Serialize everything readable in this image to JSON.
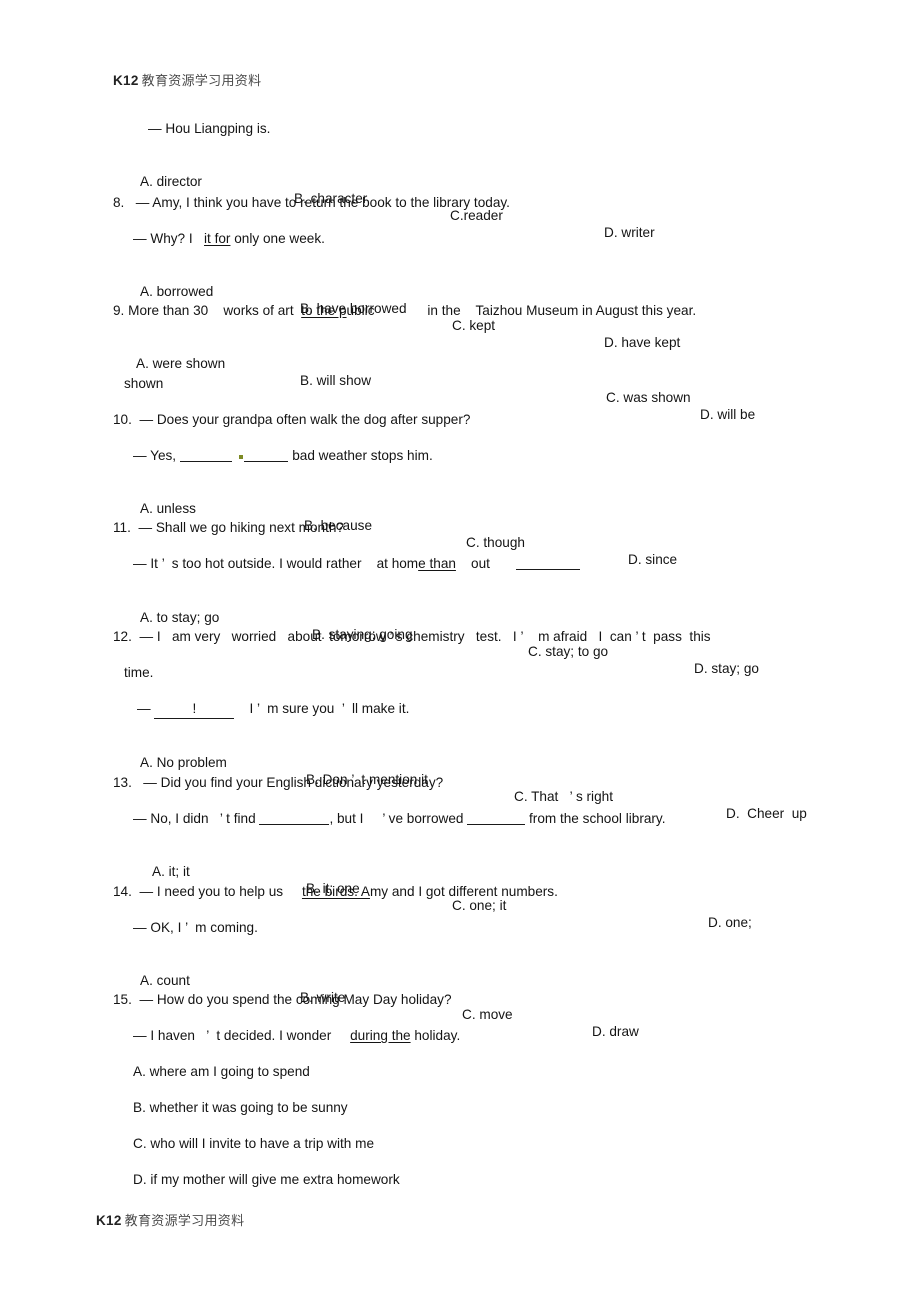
{
  "document": {
    "running_head": {
      "latin": "K12",
      "cjk": "教育资源学习用资料"
    },
    "running_foot": {
      "latin": "K12",
      "cjk": "教育资源学习用资料"
    }
  },
  "questions": [
    {
      "number": "",
      "stem": "— Hou Liangping is.",
      "options": [
        {
          "label": "A. director"
        },
        {
          "label": "B. character"
        },
        {
          "label": "C.reader"
        },
        {
          "label": "D. writer"
        }
      ]
    },
    {
      "number": "8.",
      "stem": "— Amy, I think you have to return the book to the library today.",
      "reply_pre": "— Why? I",
      "reply_underlined": "it for",
      "reply_post": " only one week.",
      "options": [
        {
          "label": "A. borrowed"
        },
        {
          "label": "B. have borrowed"
        },
        {
          "label": "C. kept"
        },
        {
          "label": "D. have kept"
        }
      ]
    },
    {
      "number": "9.",
      "stem_a": "More than 30",
      "stem_b": "works of art",
      "stem_underlined": "to the p",
      "stem_c": "ublic",
      "stem_d": "in the",
      "stem_e": "Taizhou Museum in August this year.",
      "options": [
        {
          "label": "A. were shown"
        },
        {
          "label": "B. will show"
        },
        {
          "label": "C. was shown"
        },
        {
          "label": "D. will be"
        },
        {
          "label": "shown"
        }
      ]
    },
    {
      "number": "10.",
      "stem": "— Does your grandpa often walk the dog after supper?",
      "reply_pre": "— Yes,",
      "reply_post": " bad weather stops him.",
      "options": [
        {
          "label": "A. unless"
        },
        {
          "label": "B. because"
        },
        {
          "label": "C. though"
        },
        {
          "label": "D. since"
        }
      ]
    },
    {
      "number": "11.",
      "stem": "— Shall we go hiking next month?",
      "reply_a": "— It",
      "reply_apos": "’",
      "reply_b": "s too hot outside. I would rather",
      "reply_c": "at hom",
      "reply_underlined": "e than",
      "reply_d": "out",
      "options": [
        {
          "label": "A. to stay; go"
        },
        {
          "label": "B. staying; going"
        },
        {
          "label": "C. stay; to go"
        },
        {
          "label": "D. stay; go"
        }
      ]
    },
    {
      "number": "12.",
      "stem_line1": "— I   am very   worried   about  tomorrow ’ s chemistry   test.   I ’    m afraid   I  can ’ t  pass  this",
      "stem_line2": "time.",
      "reply_dash": "—",
      "reply_blank_text": "!",
      "reply_post": "I ’  m sure you  ’  ll make it.",
      "options": [
        {
          "label": "A. No problem"
        },
        {
          "label": "B. Don ’  t mention it"
        },
        {
          "label": "C. That   ’ s right"
        },
        {
          "label": "D.  Cheer  up"
        }
      ]
    },
    {
      "number": "13.",
      "stem": "— Did you find your English dictionary yesterday?",
      "reply_a": "— No, I didn   ’ t find",
      "reply_b": ", but I",
      "reply_apos": "’",
      "reply_c": "ve borrowed",
      "reply_d": " from the school library.",
      "options": [
        {
          "label": "A. it; it"
        },
        {
          "label": "B. it; one"
        },
        {
          "label": "C. one; it"
        },
        {
          "label": "D. one;"
        }
      ]
    },
    {
      "number": "14.",
      "stem_a": "— I need you to help us",
      "stem_underlined": "the birds. A",
      "stem_b": "my and I got different numbers.",
      "reply": "— OK, I ’  m coming.",
      "options": [
        {
          "label": "A. count"
        },
        {
          "label": "B. write"
        },
        {
          "label": "C. move"
        },
        {
          "label": "D. draw"
        }
      ]
    },
    {
      "number": "15.",
      "stem": "— How do you spend the coming May Day holiday?",
      "reply_a": "— I haven   ’  t decided. I wonder",
      "reply_underlined": "during the",
      "reply_b": " holiday.",
      "options": [
        {
          "label": "A. where am I going to spend"
        },
        {
          "label": "B. whether it was going to be sunny"
        },
        {
          "label": "C. who will I invite to have a trip with me"
        },
        {
          "label": "D. if my mother will give me extra homework"
        }
      ]
    }
  ]
}
